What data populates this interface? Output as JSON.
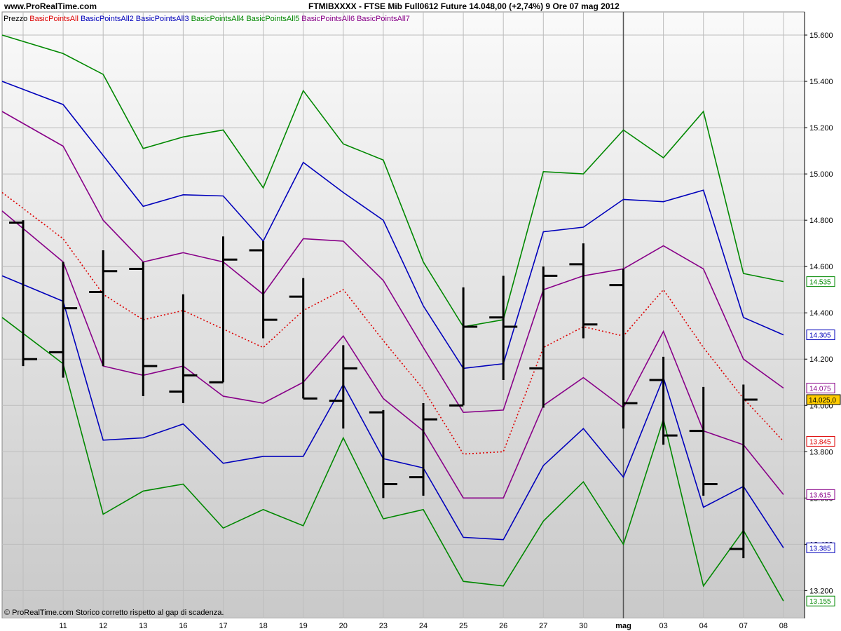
{
  "header": {
    "site": "www.ProRealTime.com",
    "title": "FTMIBXXXX - FTSE Mib Full0612 Future    14.048,00 (+2,74%)   9 Ore  07 mag 2012"
  },
  "footer": "© ProRealTime.com  Storico corretto rispetto al gap di scadenza.",
  "chart_data": {
    "type": "line",
    "legend": [
      {
        "label": "Prezzo",
        "color": "#000000"
      },
      {
        "label": "BasicPointsAll",
        "color": "#dd0000"
      },
      {
        "label": "BasicPointsAll2",
        "color": "#0000bb"
      },
      {
        "label": "BasicPointsAll3",
        "color": "#0000bb"
      },
      {
        "label": "BasicPointsAll4",
        "color": "#008800"
      },
      {
        "label": "BasicPointsAll5",
        "color": "#008800"
      },
      {
        "label": "BasicPointsAll6",
        "color": "#880088"
      },
      {
        "label": "BasicPointsAll7",
        "color": "#880088"
      }
    ],
    "x_labels": [
      "",
      "11",
      "12",
      "13",
      "16",
      "17",
      "18",
      "19",
      "20",
      "23",
      "24",
      "25",
      "26",
      "27",
      "30",
      "mag",
      "03",
      "04",
      "07",
      "08"
    ],
    "ylim": [
      13080,
      15700
    ],
    "y_ticks": [
      13200,
      13400,
      13600,
      13800,
      14000,
      14200,
      14400,
      14600,
      14800,
      15000,
      15200,
      15400,
      15600
    ],
    "y_tick_labels": [
      "13.200",
      "13.400",
      "13.600",
      "13.800",
      "14.000",
      "14.200",
      "14.400",
      "14.600",
      "14.800",
      "15.000",
      "15.200",
      "15.400",
      "15.600"
    ],
    "ohlc": [
      {
        "o": 14790,
        "h": 14800,
        "l": 14170,
        "c": 14200
      },
      {
        "o": 14230,
        "h": 14620,
        "l": 14120,
        "c": 14420
      },
      {
        "o": 14490,
        "h": 14670,
        "l": 14170,
        "c": 14580
      },
      {
        "o": 14590,
        "h": 14620,
        "l": 14040,
        "c": 14170
      },
      {
        "o": 14060,
        "h": 14480,
        "l": 14010,
        "c": 14130
      },
      {
        "o": 14100,
        "h": 14730,
        "l": 14100,
        "c": 14630
      },
      {
        "o": 14670,
        "h": 14710,
        "l": 14290,
        "c": 14370
      },
      {
        "o": 14470,
        "h": 14550,
        "l": 14030,
        "c": 14030
      },
      {
        "o": 14020,
        "h": 14260,
        "l": 13900,
        "c": 14160
      },
      {
        "o": 13970,
        "h": 13980,
        "l": 13600,
        "c": 13660
      },
      {
        "o": 13690,
        "h": 14010,
        "l": 13610,
        "c": 13940
      },
      {
        "o": 14000,
        "h": 14510,
        "l": 14000,
        "c": 14340
      },
      {
        "o": 14380,
        "h": 14560,
        "l": 14110,
        "c": 14340
      },
      {
        "o": 14160,
        "h": 14600,
        "l": 13990,
        "c": 14560
      },
      {
        "o": 14610,
        "h": 14700,
        "l": 14290,
        "c": 14350
      },
      {
        "o": 14520,
        "h": 14590,
        "l": 13900,
        "c": 14010
      },
      {
        "o": 14110,
        "h": 14210,
        "l": 13830,
        "c": 13870
      },
      {
        "o": 13890,
        "h": 14080,
        "l": 13610,
        "c": 13660
      },
      {
        "o": 13380,
        "h": 14090,
        "l": 13340,
        "c": 14025
      }
    ],
    "series": [
      {
        "name": "BasicPointsAll",
        "color": "#dd0000",
        "dashed": true,
        "start": 14920,
        "values": [
          14720,
          14480,
          14370,
          14410,
          14330,
          14250,
          14410,
          14500,
          14280,
          14070,
          13790,
          13800,
          14250,
          14340,
          14300,
          14500,
          14250,
          14030,
          13845
        ]
      },
      {
        "name": "BasicPointsAll2",
        "color": "#0000bb",
        "start": 15400,
        "values": [
          15300,
          15080,
          14860,
          14910,
          14905,
          14710,
          15050,
          14920,
          14800,
          14430,
          14160,
          14180,
          14750,
          14770,
          14890,
          14880,
          14930,
          14380,
          14305
        ]
      },
      {
        "name": "BasicPointsAll3",
        "color": "#0000bb",
        "start": 14560,
        "values": [
          14450,
          13850,
          13860,
          13920,
          13750,
          13780,
          13780,
          14090,
          13770,
          13730,
          13430,
          13420,
          13740,
          13900,
          13690,
          14120,
          13560,
          13650,
          13385
        ]
      },
      {
        "name": "BasicPointsAll4",
        "color": "#008800",
        "start": 15600,
        "values": [
          15520,
          15430,
          15110,
          15160,
          15190,
          14940,
          15360,
          15130,
          15060,
          14620,
          14340,
          14370,
          15010,
          15000,
          15190,
          15070,
          15270,
          14570,
          14535
        ]
      },
      {
        "name": "BasicPointsAll5",
        "color": "#008800",
        "start": 14380,
        "values": [
          14180,
          13530,
          13630,
          13660,
          13470,
          13550,
          13480,
          13860,
          13510,
          13550,
          13240,
          13220,
          13500,
          13670,
          13400,
          13940,
          13220,
          13460,
          13155
        ]
      },
      {
        "name": "BasicPointsAll6",
        "color": "#880088",
        "start": 15270,
        "values": [
          15120,
          14800,
          14620,
          14660,
          14620,
          14480,
          14720,
          14710,
          14540,
          14250,
          13970,
          13980,
          14500,
          14560,
          14590,
          14690,
          14590,
          14200,
          14075
        ]
      },
      {
        "name": "BasicPointsAll7",
        "color": "#880088",
        "start": 14840,
        "values": [
          14620,
          14170,
          14130,
          14170,
          14040,
          14010,
          14100,
          14300,
          14030,
          13890,
          13600,
          13600,
          14000,
          14120,
          13990,
          14320,
          13890,
          13830,
          13615
        ]
      }
    ],
    "last_price": {
      "value": 14025,
      "label": "14.025,0",
      "color": "#ffcc00"
    },
    "last_value_tags": [
      {
        "value": 14535,
        "label": "14.535",
        "color": "#008800"
      },
      {
        "value": 14305,
        "label": "14.305",
        "color": "#0000bb"
      },
      {
        "value": 14075,
        "label": "14.075",
        "color": "#880088"
      },
      {
        "value": 13845,
        "label": "13.845",
        "color": "#dd0000"
      },
      {
        "value": 13615,
        "label": "13.615",
        "color": "#880088"
      },
      {
        "value": 13385,
        "label": "13.385",
        "color": "#0000bb"
      },
      {
        "value": 13155,
        "label": "13.155",
        "color": "#008800"
      }
    ]
  }
}
